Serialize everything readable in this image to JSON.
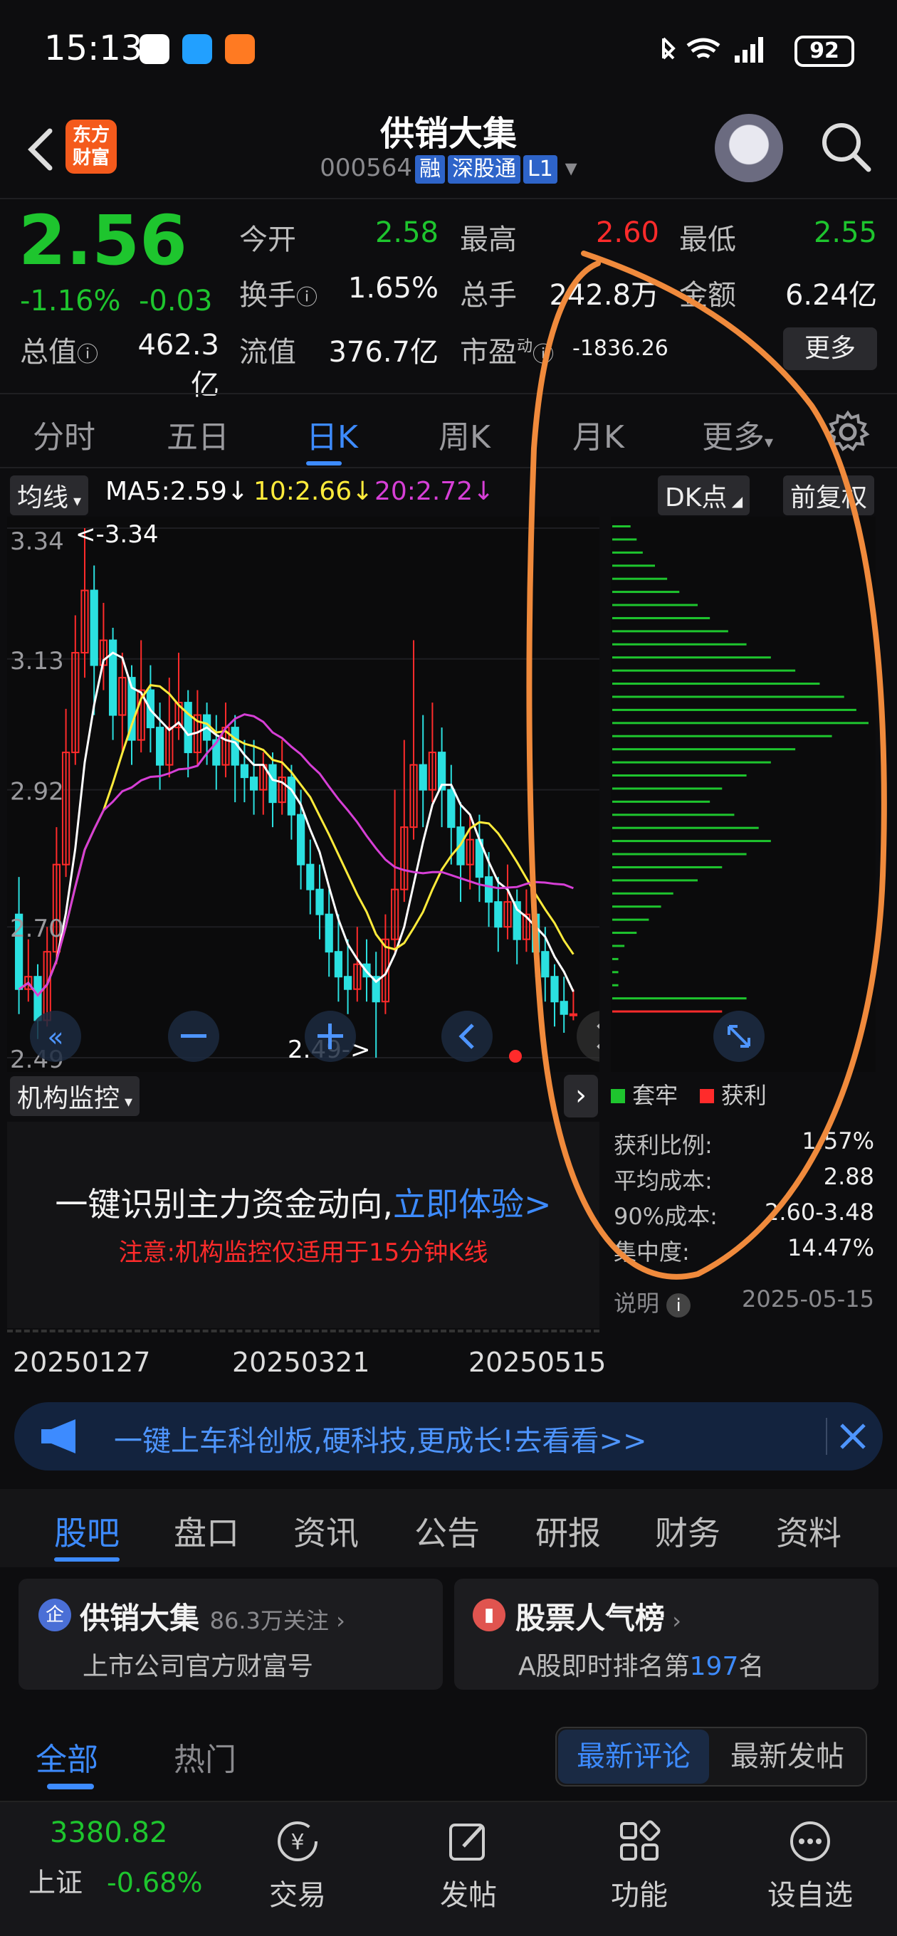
{
  "status_bar": {
    "time": "15:13",
    "battery": "92"
  },
  "header": {
    "brand_line1": "东方",
    "brand_line2": "财富",
    "stock_name": "供销大集",
    "stock_code": "000564",
    "tag_margin": "融",
    "tag_connect": "深股通",
    "tag_level": "L1"
  },
  "quote": {
    "price": "2.56",
    "change_pct": "-1.16%",
    "change_amt": "-0.03",
    "open_label": "今开",
    "open": "2.58",
    "high_label": "最高",
    "high": "2.60",
    "low_label": "最低",
    "low": "2.55",
    "turnover_label": "换手",
    "turnover": "1.65%",
    "volume_label": "总手",
    "volume": "242.8万",
    "amount_label": "金额",
    "amount": "6.24亿",
    "mktcap_label": "总值",
    "mktcap": "462.3亿",
    "float_label": "流值",
    "float_cap": "376.7亿",
    "pe_label": "市盈",
    "pe_sup": "动",
    "pe": "-1836.26",
    "more_label": "更多"
  },
  "period_tabs": [
    "分时",
    "五日",
    "日K",
    "周K",
    "月K",
    "更多"
  ],
  "ma_bar": {
    "selector": "均线",
    "ma5": "MA5:2.59",
    "ma10": "10:2.66",
    "ma20": "20:2.72",
    "dk_label": "DK点",
    "adjust_label": "前复权",
    "color_ma5": "#ffffff",
    "color_ma10": "#ffeb3b",
    "color_ma20": "#d63fd6"
  },
  "chart_data": {
    "type": "candlestick",
    "y_ticks": [
      "3.34",
      "3.13",
      "2.92",
      "2.70",
      "2.49"
    ],
    "ylim": [
      2.49,
      3.34
    ],
    "max_label": "<-3.34",
    "min_label": "2.49->",
    "x_ticks": [
      "20250127",
      "20250321",
      "20250515"
    ],
    "candles": [
      [
        2.72,
        2.6,
        2.78,
        2.56
      ],
      [
        2.6,
        2.62,
        2.68,
        2.58
      ],
      [
        2.62,
        2.55,
        2.64,
        2.52
      ],
      [
        2.55,
        2.66,
        2.7,
        2.54
      ],
      [
        2.66,
        2.8,
        2.86,
        2.64
      ],
      [
        2.8,
        2.98,
        3.05,
        2.78
      ],
      [
        2.98,
        3.14,
        3.2,
        2.96
      ],
      [
        3.14,
        3.24,
        3.34,
        3.1
      ],
      [
        3.24,
        3.12,
        3.28,
        3.04
      ],
      [
        3.12,
        3.16,
        3.22,
        3.08
      ],
      [
        3.16,
        3.04,
        3.18,
        3.0
      ],
      [
        3.04,
        3.1,
        3.14,
        2.98
      ],
      [
        3.1,
        3.0,
        3.12,
        2.96
      ],
      [
        3.0,
        3.08,
        3.16,
        2.98
      ],
      [
        3.08,
        3.02,
        3.12,
        2.98
      ],
      [
        3.02,
        2.96,
        3.06,
        2.92
      ],
      [
        2.96,
        3.02,
        3.1,
        2.94
      ],
      [
        3.02,
        3.06,
        3.14,
        3.0
      ],
      [
        3.06,
        2.98,
        3.08,
        2.94
      ],
      [
        2.98,
        3.04,
        3.08,
        2.96
      ],
      [
        3.04,
        3.0,
        3.06,
        2.96
      ],
      [
        3.0,
        2.96,
        3.04,
        2.92
      ],
      [
        2.96,
        3.02,
        3.06,
        2.94
      ],
      [
        3.02,
        2.96,
        3.04,
        2.9
      ],
      [
        2.96,
        2.94,
        3.0,
        2.9
      ],
      [
        2.94,
        2.92,
        3.0,
        2.88
      ],
      [
        2.92,
        2.96,
        2.98,
        2.88
      ],
      [
        2.96,
        2.9,
        2.98,
        2.86
      ],
      [
        2.9,
        2.94,
        3.0,
        2.88
      ],
      [
        2.94,
        2.88,
        2.96,
        2.84
      ],
      [
        2.88,
        2.8,
        2.92,
        2.76
      ],
      [
        2.8,
        2.76,
        2.84,
        2.72
      ],
      [
        2.76,
        2.72,
        2.8,
        2.68
      ],
      [
        2.72,
        2.66,
        2.76,
        2.62
      ],
      [
        2.66,
        2.62,
        2.72,
        2.58
      ],
      [
        2.62,
        2.6,
        2.68,
        2.56
      ],
      [
        2.6,
        2.64,
        2.7,
        2.58
      ],
      [
        2.64,
        2.62,
        2.68,
        2.58
      ],
      [
        2.62,
        2.58,
        2.66,
        2.49
      ],
      [
        2.58,
        2.68,
        2.72,
        2.56
      ],
      [
        2.68,
        2.76,
        2.92,
        2.66
      ],
      [
        2.76,
        2.86,
        3.0,
        2.74
      ],
      [
        2.86,
        2.96,
        3.16,
        2.84
      ],
      [
        2.96,
        2.92,
        3.04,
        2.86
      ],
      [
        2.92,
        2.98,
        3.06,
        2.9
      ],
      [
        2.98,
        2.92,
        3.02,
        2.86
      ],
      [
        2.92,
        2.86,
        2.96,
        2.8
      ],
      [
        2.86,
        2.8,
        2.9,
        2.74
      ],
      [
        2.8,
        2.84,
        2.88,
        2.76
      ],
      [
        2.84,
        2.78,
        2.88,
        2.74
      ],
      [
        2.78,
        2.74,
        2.82,
        2.7
      ],
      [
        2.74,
        2.7,
        2.78,
        2.66
      ],
      [
        2.7,
        2.74,
        2.8,
        2.68
      ],
      [
        2.74,
        2.68,
        2.76,
        2.64
      ],
      [
        2.68,
        2.72,
        2.76,
        2.66
      ],
      [
        2.72,
        2.66,
        2.74,
        2.62
      ],
      [
        2.66,
        2.62,
        2.7,
        2.58
      ],
      [
        2.62,
        2.58,
        2.64,
        2.54
      ],
      [
        2.58,
        2.56,
        2.62,
        2.53
      ],
      [
        2.56,
        2.56,
        2.6,
        2.55
      ]
    ],
    "chip_values": [
      3,
      4,
      5,
      7,
      9,
      11,
      14,
      16,
      19,
      22,
      26,
      30,
      34,
      38,
      40,
      42,
      36,
      30,
      26,
      22,
      18,
      16,
      20,
      24,
      26,
      22,
      18,
      14,
      10,
      8,
      6,
      4,
      2,
      1,
      1,
      1,
      22,
      18
    ],
    "chip_legend_trapped": "套牢",
    "chip_legend_profit": "获利",
    "stats": [
      {
        "label": "获利比例:",
        "value": "1.57%"
      },
      {
        "label": "平均成本:",
        "value": "2.88"
      },
      {
        "label": "90%成本:",
        "value": "2.60-3.48"
      },
      {
        "label": "集中度:",
        "value": "14.47%"
      }
    ],
    "note_label": "说明",
    "chip_date": "2025-05-15"
  },
  "monitor": {
    "selector": "机构监控",
    "main_text": "一键识别主力资金动向,",
    "cta": "立即体验>",
    "note": "注意:机构监控仅适用于15分钟K线"
  },
  "banner": {
    "text": "一键上车科创板,硬科技,更成长!去看看>>"
  },
  "section_tabs": [
    "股吧",
    "盘口",
    "资讯",
    "公告",
    "研报",
    "财务",
    "资料"
  ],
  "cards": {
    "left_title": "供销大集",
    "left_follow": "86.3万关注",
    "left_sub": "上市公司官方财富号",
    "right_title": "股票人气榜",
    "right_sub_pre": "A股即时排名第",
    "right_rank": "197",
    "right_sub_post": "名"
  },
  "filter": {
    "all": "全部",
    "hot": "热门",
    "latest_comment": "最新评论",
    "latest_post": "最新发帖"
  },
  "bottom_nav": {
    "index_value": "3380.82",
    "index_name": "上证",
    "index_change": "-0.68%",
    "items": [
      "交易",
      "发帖",
      "功能",
      "设自选"
    ]
  }
}
